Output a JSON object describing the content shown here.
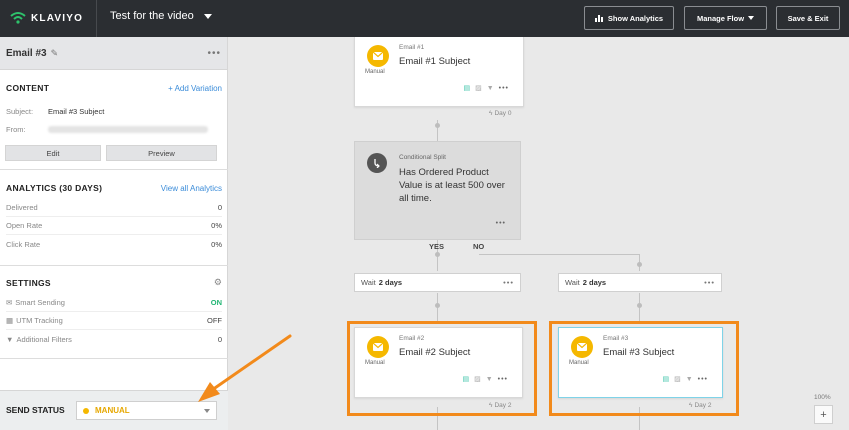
{
  "topbar": {
    "brand": "KLAVIYO",
    "flow_title": "Test for the video",
    "show_analytics": "Show Analytics",
    "manage_flow": "Manage Flow",
    "save_exit": "Save & Exit"
  },
  "panel": {
    "title": "Email #3",
    "content": {
      "heading": "CONTENT",
      "add_variation": "+ Add Variation",
      "subject_label": "Subject:",
      "subject_value": "Email #3 Subject",
      "from_label": "From:",
      "edit": "Edit",
      "preview": "Preview"
    },
    "analytics": {
      "heading": "ANALYTICS (30 DAYS)",
      "view_all": "View all Analytics",
      "rows": [
        {
          "label": "Delivered",
          "value": "0"
        },
        {
          "label": "Open Rate",
          "value": "0%"
        },
        {
          "label": "Click Rate",
          "value": "0%"
        }
      ]
    },
    "settings": {
      "heading": "SETTINGS",
      "rows": [
        {
          "label": "Smart Sending",
          "value": "ON"
        },
        {
          "label": "UTM Tracking",
          "value": "OFF"
        },
        {
          "label": "Additional Filters",
          "value": "0"
        }
      ]
    },
    "send_status": {
      "label": "SEND STATUS",
      "value": "MANUAL"
    }
  },
  "canvas": {
    "email1": {
      "kind": "Email #1",
      "subject": "Email #1 Subject",
      "mode": "Manual",
      "day": "Day 0"
    },
    "split": {
      "kind": "Conditional Split",
      "description": "Has Ordered Product Value is at least 500 over all time."
    },
    "yes": "YES",
    "no": "NO",
    "wait_left": {
      "prefix": "Wait",
      "value": "2 days"
    },
    "wait_right": {
      "prefix": "Wait",
      "value": "2 days"
    },
    "email2": {
      "kind": "Email #2",
      "subject": "Email #2 Subject",
      "mode": "Manual",
      "day": "Day 2"
    },
    "email3": {
      "kind": "Email #3",
      "subject": "Email #3 Subject",
      "mode": "Manual",
      "day": "Day 2"
    },
    "zoom": "100%",
    "zoom_in": "+"
  },
  "colors": {
    "topbar": "#2b2e32",
    "accent_link": "#3b8cd9",
    "manual_yellow": "#f5b800",
    "highlight_orange": "#f28a1b",
    "on_green": "#21b573"
  }
}
